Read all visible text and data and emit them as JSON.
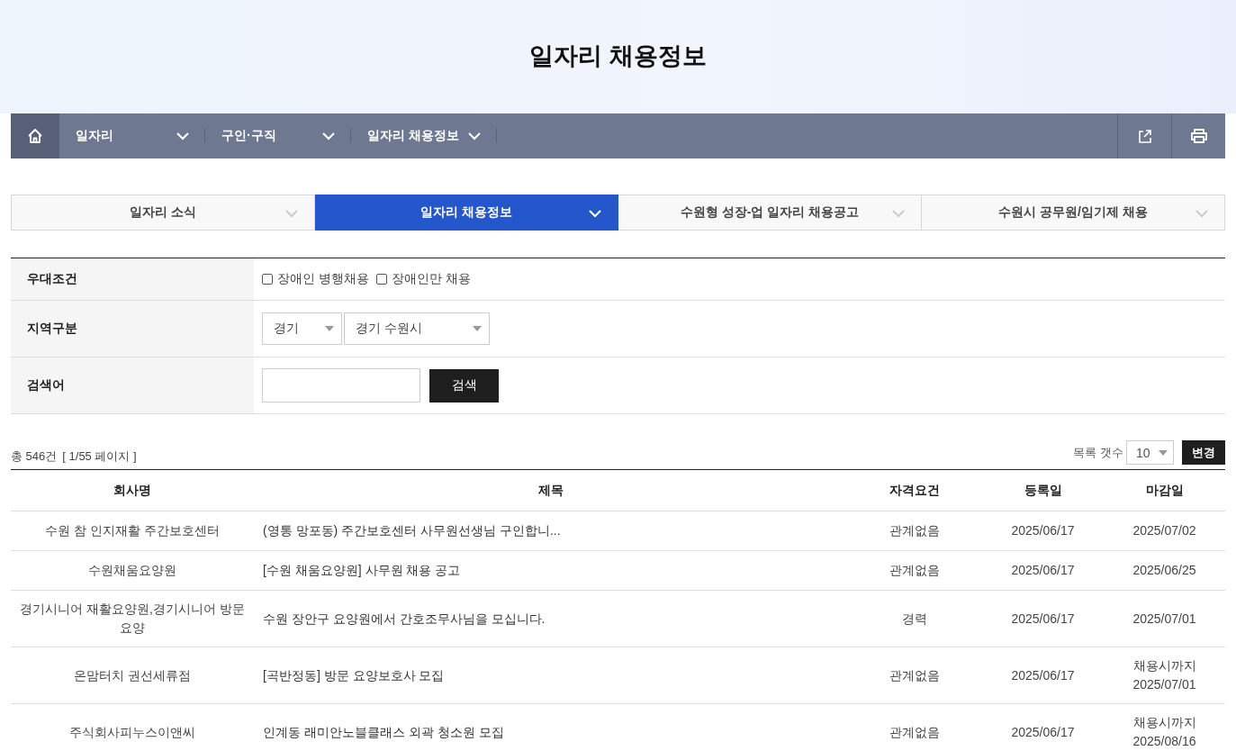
{
  "page_title": "일자리 채용정보",
  "breadcrumb": [
    {
      "label": "일자리"
    },
    {
      "label": "구인·구직"
    },
    {
      "label": "일자리 채용정보"
    }
  ],
  "tabs": [
    {
      "label": "일자리 소식",
      "selected": false
    },
    {
      "label": "일자리 채용정보",
      "selected": true
    },
    {
      "label": "수원형 성장-업 일자리 채용공고",
      "selected": false
    },
    {
      "label": "수원시 공무원/임기제 채용",
      "selected": false
    }
  ],
  "filters": {
    "preference": {
      "label": "우대조건",
      "options": [
        {
          "label": "장애인 병행채용",
          "checked": false
        },
        {
          "label": "장애인만 채용",
          "checked": false
        }
      ]
    },
    "region": {
      "label": "지역구분",
      "selects": [
        "경기",
        "경기 수원시"
      ]
    },
    "keyword": {
      "label": "검색어",
      "button": "검색"
    }
  },
  "summary": {
    "total": "총 546건",
    "page": "[ 1/55 페이지 ]"
  },
  "page_size": {
    "label": "목록 갯수",
    "value": "10",
    "button": "변경"
  },
  "table": {
    "columns": [
      "회사명",
      "제목",
      "자격요건",
      "등록일",
      "마감일"
    ],
    "rows": [
      {
        "company": "수원 참 인지재활 주간보호센터",
        "title": "(영통 망포동) 주간보호센터 사무원선생님 구인합니...",
        "qualification": "관계없음",
        "registered": "2025/06/17",
        "deadline": "2025/07/02"
      },
      {
        "company": "수원채움요양원",
        "title": "[수원 채움요양원] 사무원 채용 공고",
        "qualification": "관계없음",
        "registered": "2025/06/17",
        "deadline": "2025/06/25"
      },
      {
        "company": "경기시니어 재활요양원,경기시니어 방문요양",
        "title": "수원 장안구 요양원에서 간호조무사님을 모십니다.",
        "qualification": "경력",
        "registered": "2025/06/17",
        "deadline": "2025/07/01"
      },
      {
        "company": "온맘터치 권선세류점",
        "title": "[곡반정동] 방문 요양보호사 모집",
        "qualification": "관계없음",
        "registered": "2025/06/17",
        "deadline_note": "채용시까지",
        "deadline": "2025/07/01"
      },
      {
        "company": "주식회사피누스이앤씨",
        "title": "인계동 래미안노블클래스 외곽 청소원 모집",
        "qualification": "관계없음",
        "registered": "2025/06/17",
        "deadline_note": "채용시까지",
        "deadline": "2025/08/16"
      }
    ]
  }
}
